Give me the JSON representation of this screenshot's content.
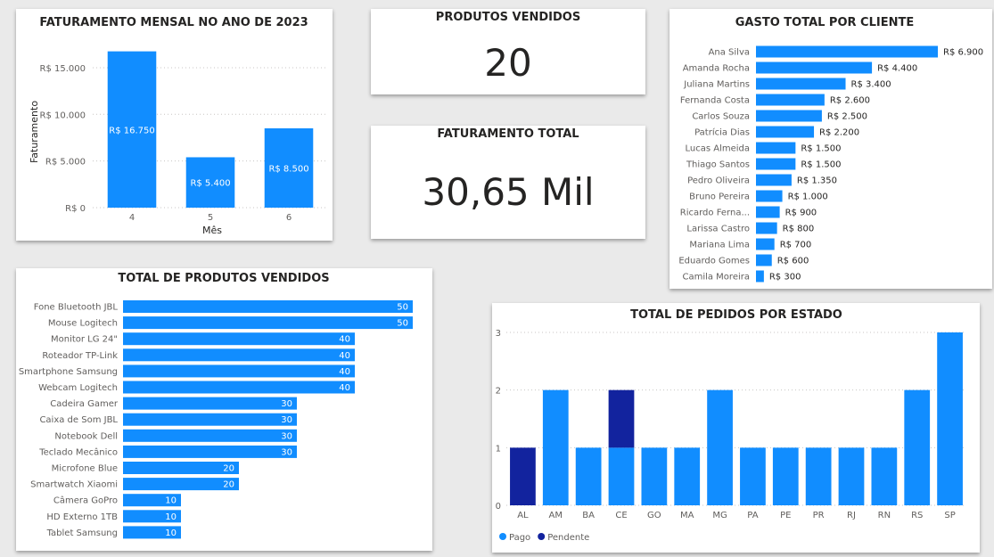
{
  "theme": {
    "pago": "#118dff",
    "pendente": "#12239e"
  },
  "kpis": {
    "produtos_vendidos": {
      "title": "PRODUTOS VENDIDOS",
      "value": "20"
    },
    "faturamento_total": {
      "title": "FATURAMENTO TOTAL",
      "value": "30,65 Mil"
    }
  },
  "chart_data": [
    {
      "id": "faturamento_mensal",
      "type": "bar",
      "title": "FATURAMENTO MENSAL NO ANO DE 2023",
      "xlabel": "Mês",
      "ylabel": "Faturamento",
      "categories": [
        "4",
        "5",
        "6"
      ],
      "values": [
        16750,
        5400,
        8500
      ],
      "value_labels": [
        "R$ 16.750",
        "R$ 5.400",
        "R$ 8.500"
      ],
      "yticks": [
        0,
        5000,
        10000,
        15000
      ],
      "ytick_labels": [
        "R$ 0",
        "R$ 5.000",
        "R$ 10.000",
        "R$ 15.000"
      ],
      "ylim": [
        0,
        17000
      ],
      "grid": true
    },
    {
      "id": "gasto_por_cliente",
      "type": "bar",
      "orientation": "horizontal",
      "title": "GASTO TOTAL POR CLIENTE",
      "categories": [
        "Ana Silva",
        "Amanda Rocha",
        "Juliana Martins",
        "Fernanda Costa",
        "Carlos Souza",
        "Patrícia Dias",
        "Lucas Almeida",
        "Thiago Santos",
        "Pedro Oliveira",
        "Bruno Pereira",
        "Ricardo Ferna...",
        "Larissa Castro",
        "Mariana Lima",
        "Eduardo Gomes",
        "Camila Moreira"
      ],
      "values": [
        6900,
        4400,
        3400,
        2600,
        2500,
        2200,
        1500,
        1500,
        1350,
        1000,
        900,
        800,
        700,
        600,
        300
      ],
      "value_labels": [
        "R$ 6.900",
        "R$ 4.400",
        "R$ 3.400",
        "R$ 2.600",
        "R$ 2.500",
        "R$ 2.200",
        "R$ 1.500",
        "R$ 1.500",
        "R$ 1.350",
        "R$ 1.000",
        "R$ 900",
        "R$ 800",
        "R$ 700",
        "R$ 600",
        "R$ 300"
      ]
    },
    {
      "id": "produtos_vendidos",
      "type": "bar",
      "orientation": "horizontal",
      "title": "TOTAL DE PRODUTOS VENDIDOS",
      "categories": [
        "Fone Bluetooth JBL",
        "Mouse Logitech",
        "Monitor LG 24\"",
        "Roteador TP-Link",
        "Smartphone Samsung",
        "Webcam Logitech",
        "Cadeira Gamer",
        "Caixa de Som JBL",
        "Notebook Dell",
        "Teclado Mecânico",
        "Microfone Blue",
        "Smartwatch Xiaomi",
        "Câmera GoPro",
        "HD Externo 1TB",
        "Tablet Samsung"
      ],
      "values": [
        50,
        50,
        40,
        40,
        40,
        40,
        30,
        30,
        30,
        30,
        20,
        20,
        10,
        10,
        10
      ]
    },
    {
      "id": "pedidos_por_estado",
      "type": "bar",
      "stacked": true,
      "title": "TOTAL DE PEDIDOS POR ESTADO",
      "categories": [
        "AL",
        "AM",
        "BA",
        "CE",
        "GO",
        "MA",
        "MG",
        "PA",
        "PE",
        "PR",
        "RJ",
        "RN",
        "RS",
        "SP"
      ],
      "series": [
        {
          "name": "Pago",
          "values": [
            0,
            2,
            1,
            1,
            1,
            1,
            2,
            1,
            1,
            1,
            1,
            1,
            2,
            3
          ]
        },
        {
          "name": "Pendente",
          "values": [
            1,
            0,
            0,
            1,
            0,
            0,
            0,
            0,
            0,
            0,
            0,
            0,
            0,
            0
          ]
        }
      ],
      "yticks": [
        0,
        1,
        2,
        3
      ],
      "ylim": [
        0,
        3
      ],
      "grid": true,
      "legend": "bottom-left"
    }
  ]
}
